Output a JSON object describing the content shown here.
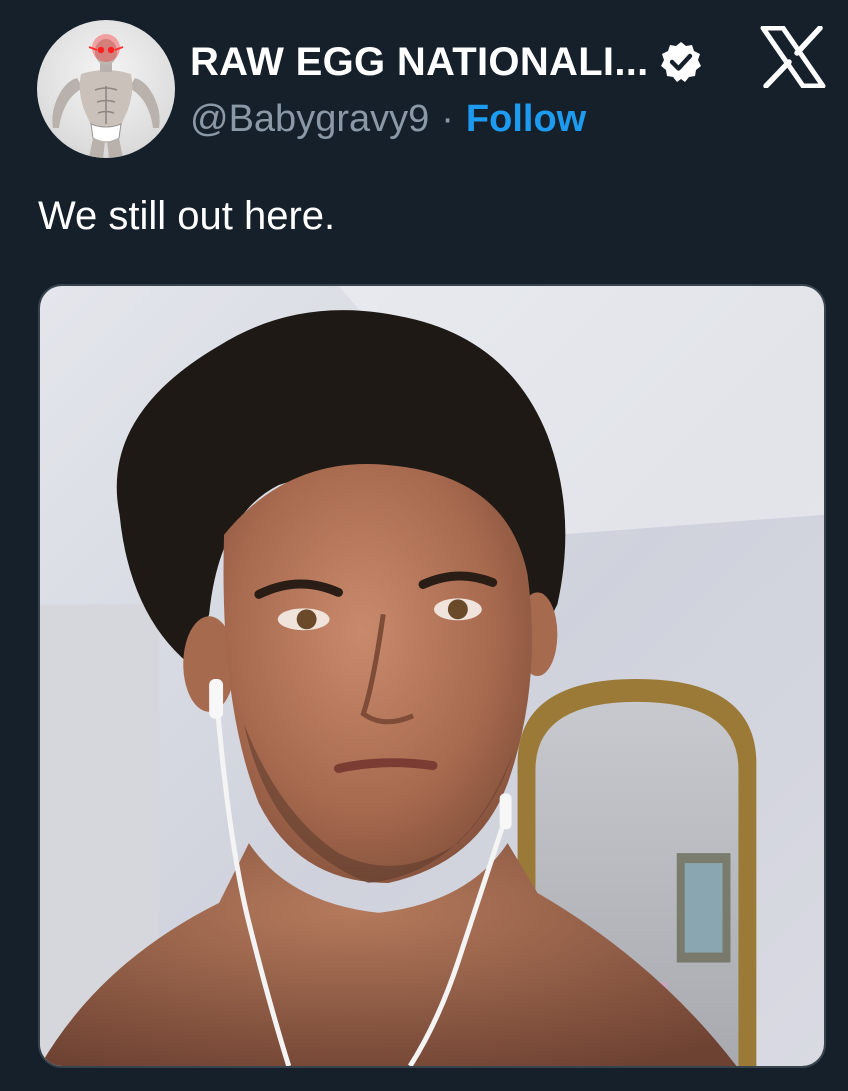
{
  "author": {
    "display_name": "RAW EGG NATIONALI...",
    "handle": "@Babygravy9",
    "separator": "·",
    "follow_label": "Follow",
    "verified": true,
    "avatar_icon": "bodybuilder-avatar"
  },
  "platform": {
    "logo_icon": "x-logo-icon"
  },
  "tweet": {
    "text": "We still out here.",
    "media": {
      "type": "photo",
      "subject": "selfie-photo"
    }
  },
  "colors": {
    "background": "#15202b",
    "text_primary": "#ffffff",
    "text_secondary": "#8b98a5",
    "link": "#1d9bf0",
    "border": "#38444d"
  }
}
